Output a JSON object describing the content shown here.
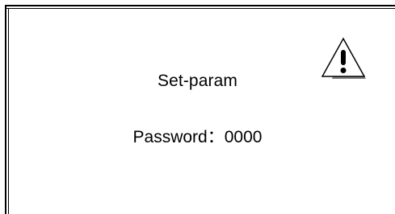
{
  "dialog": {
    "title": "Set-param",
    "password_label": "Password：",
    "password_value": "0000"
  },
  "icons": {
    "warning": "warning-triangle-icon"
  }
}
